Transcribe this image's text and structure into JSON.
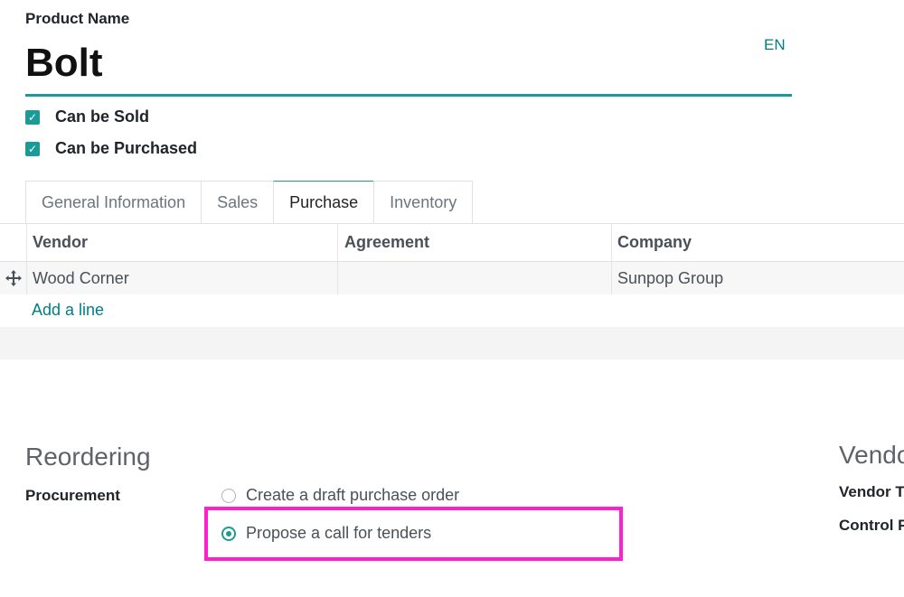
{
  "product": {
    "name_label": "Product Name",
    "name": "Bolt",
    "lang": "EN",
    "can_be_sold": {
      "label": "Can be Sold",
      "checked": true
    },
    "can_be_purchased": {
      "label": "Can be Purchased",
      "checked": true
    }
  },
  "tabs": [
    {
      "label": "General Information",
      "active": false
    },
    {
      "label": "Sales",
      "active": false
    },
    {
      "label": "Purchase",
      "active": true
    },
    {
      "label": "Inventory",
      "active": false
    }
  ],
  "vendor_table": {
    "columns": [
      "Vendor",
      "Agreement",
      "Company"
    ],
    "rows": [
      {
        "vendor": "Wood Corner",
        "agreement": "",
        "company": "Sunpop Group"
      }
    ],
    "add_line": "Add a line"
  },
  "reordering": {
    "title": "Reordering",
    "procurement_label": "Procurement",
    "options": [
      {
        "label": "Create a draft purchase order",
        "selected": false
      },
      {
        "label": "Propose a call for tenders",
        "selected": true
      }
    ]
  },
  "vendor_bills": {
    "title": "Vendor Bills",
    "fields": [
      "Vendor Taxes",
      "Control Policy"
    ]
  },
  "colors": {
    "accent": "#1b9a97",
    "link": "#017e84",
    "highlight": "#ff1fd1"
  }
}
